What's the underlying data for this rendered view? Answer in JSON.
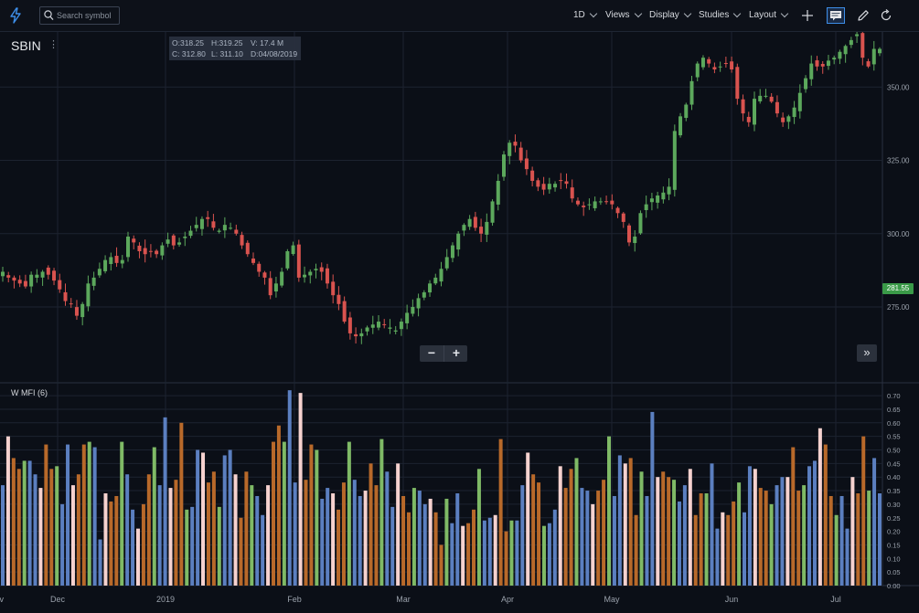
{
  "toolbar": {
    "search_placeholder": "Search symbol",
    "interval": "1D",
    "views": "Views",
    "display": "Display",
    "studies": "Studies",
    "layout": "Layout"
  },
  "symbol": "SBIN",
  "ohlc": {
    "open": "O:318.25",
    "high": "H:319.25",
    "volume": "V: 17.4 M",
    "close": "C: 312.80",
    "low": "L: 311.10",
    "date": "D:04/08/2019"
  },
  "last_price": "281.55",
  "zoom": {
    "minus": "−",
    "plus": "+"
  },
  "forward_label": "»",
  "indicator_label": "W MFI (6)",
  "colors": {
    "up": "#5ca85c",
    "down": "#d9534f",
    "mfi_blue": "#5b7fc0",
    "mfi_green": "#7fba66",
    "mfi_brown": "#b8692a",
    "mfi_pink": "#f6d2cf",
    "last_price_tag": "#3a9a48"
  },
  "chart_data": [
    {
      "type": "candlestick",
      "title": "SBIN",
      "y_ticks": [
        "350.00",
        "325.00",
        "300.00",
        "275.00"
      ],
      "ylim": [
        262,
        372
      ],
      "x_ticks": [
        "Nov",
        "Dec",
        "2019",
        "Feb",
        "Mar",
        "Apr",
        "May",
        "Jun",
        "Jul"
      ],
      "grid": true,
      "close_series": [
        287,
        285,
        284,
        283,
        282,
        286,
        286,
        287,
        286,
        284,
        281,
        277,
        276,
        272,
        276,
        283,
        285,
        288,
        291,
        292,
        290,
        291,
        299,
        297,
        294,
        293,
        294,
        293,
        296,
        298,
        296,
        297,
        299,
        301,
        303,
        305,
        305,
        302,
        301,
        303,
        302,
        300,
        296,
        293,
        290,
        287,
        285,
        279,
        283,
        287,
        294,
        296,
        285,
        286,
        287,
        288,
        287,
        283,
        279,
        276,
        270,
        266,
        265,
        266,
        268,
        269,
        270,
        269,
        268,
        267,
        270,
        273,
        275,
        278,
        280,
        283,
        285,
        288,
        292,
        296,
        300,
        303,
        305,
        302,
        300,
        304,
        311,
        318,
        327,
        331,
        330,
        325,
        322,
        318,
        316,
        315,
        317,
        317,
        318,
        317,
        312,
        310,
        309,
        310,
        311,
        311,
        311,
        310,
        307,
        304,
        297,
        299,
        307,
        310,
        312,
        313,
        314,
        316,
        335,
        340,
        344,
        352,
        358,
        360,
        358,
        356,
        357,
        358,
        356,
        346,
        341,
        338,
        346,
        347,
        347,
        345,
        341,
        338,
        340,
        343,
        348,
        353,
        358,
        357,
        357,
        359,
        360,
        362,
        364,
        366,
        368,
        360,
        357,
        363,
        363
      ]
    },
    {
      "type": "bar",
      "title": "W MFI (6)",
      "y_ticks": [
        "0.70",
        "0.65",
        "0.60",
        "0.55",
        "0.50",
        "0.45",
        "0.40",
        "0.35",
        "0.30",
        "0.25",
        "0.20",
        "0.15",
        "0.10",
        "0.05",
        "0.00"
      ],
      "ylim": [
        0,
        0.72
      ],
      "values": [
        0.37,
        0.55,
        0.47,
        0.43,
        0.46,
        0.46,
        0.41,
        0.36,
        0.52,
        0.43,
        0.44,
        0.3,
        0.52,
        0.37,
        0.41,
        0.52,
        0.53,
        0.51,
        0.17,
        0.34,
        0.31,
        0.33,
        0.53,
        0.41,
        0.28,
        0.21,
        0.3,
        0.41,
        0.51,
        0.37,
        0.62,
        0.36,
        0.39,
        0.6,
        0.28,
        0.29,
        0.5,
        0.49,
        0.38,
        0.42,
        0.29,
        0.48,
        0.5,
        0.41,
        0.25,
        0.42,
        0.37,
        0.33,
        0.26,
        0.37,
        0.53,
        0.59,
        0.53,
        0.72,
        0.38,
        0.71,
        0.39,
        0.52,
        0.5,
        0.32,
        0.36,
        0.34,
        0.28,
        0.38,
        0.53,
        0.39,
        0.33,
        0.35,
        0.45,
        0.37,
        0.54,
        0.42,
        0.29,
        0.45,
        0.33,
        0.27,
        0.36,
        0.35,
        0.3,
        0.32,
        0.27,
        0.15,
        0.32,
        0.23,
        0.34,
        0.22,
        0.23,
        0.28,
        0.43,
        0.24,
        0.25,
        0.26,
        0.54,
        0.2,
        0.24,
        0.24,
        0.37,
        0.49,
        0.41,
        0.38,
        0.22,
        0.23,
        0.28,
        0.44,
        0.36,
        0.43,
        0.47,
        0.36,
        0.35,
        0.3,
        0.35,
        0.39,
        0.55,
        0.33,
        0.48,
        0.45,
        0.47,
        0.26,
        0.42,
        0.33,
        0.64,
        0.4,
        0.42,
        0.4,
        0.39,
        0.31,
        0.37,
        0.43,
        0.26,
        0.34,
        0.34,
        0.45,
        0.21,
        0.27,
        0.26,
        0.31,
        0.38,
        0.27,
        0.44,
        0.43,
        0.36,
        0.35,
        0.3,
        0.37,
        0.4,
        0.4,
        0.51,
        0.35,
        0.37,
        0.44,
        0.46,
        0.58,
        0.52,
        0.33,
        0.26,
        0.33,
        0.21,
        0.4,
        0.34,
        0.55,
        0.35,
        0.47,
        0.34
      ]
    }
  ]
}
